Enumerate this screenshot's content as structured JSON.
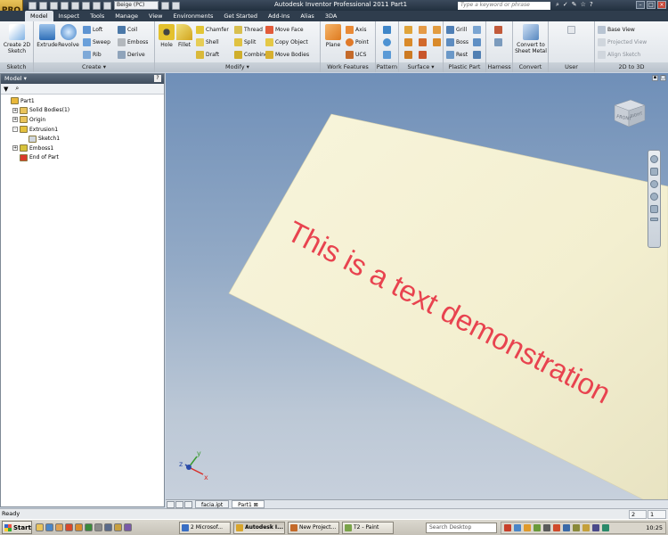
{
  "titlebar": {
    "title": "Autodesk Inventor Professional 2011 Part1",
    "app_button_label": "PRO",
    "appearance_combo": "Beige (PC)",
    "search_placeholder": "Type a keyword or phrase",
    "help_label": "?"
  },
  "tabs": [
    "Model",
    "Inspect",
    "Tools",
    "Manage",
    "View",
    "Environments",
    "Get Started",
    "Add-Ins",
    "Alias",
    "3DA"
  ],
  "active_tab": "Model",
  "ribbon": {
    "sketch": {
      "label": "Sketch",
      "create_2d_sketch": "Create 2D Sketch"
    },
    "create": {
      "label": "Create",
      "extrude": "Extrude",
      "revolve": "Revolve",
      "loft": "Loft",
      "sweep": "Sweep",
      "rib": "Rib",
      "coil": "Coil",
      "emboss": "Emboss",
      "derive": "Derive"
    },
    "modify": {
      "label": "Modify",
      "hole": "Hole",
      "fillet": "Fillet",
      "chamfer": "Chamfer",
      "shell": "Shell",
      "draft": "Draft",
      "thread": "Thread",
      "split": "Split",
      "combine": "Combine",
      "move_face": "Move Face",
      "copy_object": "Copy Object",
      "move_bodies": "Move Bodies"
    },
    "work_features": {
      "label": "Work Features",
      "plane": "Plane",
      "axis": "Axis",
      "point": "Point",
      "ucs": "UCS"
    },
    "pattern": {
      "label": "Pattern"
    },
    "surface": {
      "label": "Surface"
    },
    "plastic_part": {
      "label": "Plastic Part",
      "grill": "Grill",
      "boss": "Boss",
      "rest": "Rest"
    },
    "harness": {
      "label": "Harness"
    },
    "convert": {
      "label": "Convert",
      "convert_to_sheet_metal": "Convert to Sheet Metal"
    },
    "user_commands": {
      "label": "User Commands"
    },
    "two_d_to_3d": {
      "label": "2D to 3D",
      "base_view": "Base View",
      "projected_view": "Projected View",
      "align_sketch": "Align Sketch"
    }
  },
  "browser": {
    "title": "Model",
    "help": "?",
    "tree": [
      {
        "label": "Part1",
        "level": 0,
        "expander": "",
        "color": "#e9b83a"
      },
      {
        "label": "Solid Bodies(1)",
        "level": 1,
        "expander": "+",
        "color": "#e9c35a"
      },
      {
        "label": "Origin",
        "level": 1,
        "expander": "+",
        "color": "#e9c35a"
      },
      {
        "label": "Extrusion1",
        "level": 1,
        "expander": "-",
        "color": "#e5c13c"
      },
      {
        "label": "Sketch1",
        "level": 2,
        "expander": "",
        "color": "#cfd6de"
      },
      {
        "label": "Emboss1",
        "level": 1,
        "expander": "+",
        "color": "#d7c23a"
      },
      {
        "label": "End of Part",
        "level": 1,
        "expander": "",
        "color": "#d9392b"
      }
    ]
  },
  "viewport": {
    "embossed_text": "This is a text demonstration",
    "text_color": "#e8434f",
    "face_color": "#f4f0cf",
    "viewcube_front": "FRONT",
    "viewcube_right": "RIGHT",
    "triad": {
      "x": "x",
      "y": "y",
      "z": "z"
    }
  },
  "doc_tabs": [
    "facia.ipt",
    "Part1"
  ],
  "active_doc": "Part1",
  "status": {
    "text": "Ready",
    "count1": "2",
    "count2": "1"
  },
  "taskbar": {
    "start": "Start",
    "buttons": [
      {
        "label": "2 Microsof...",
        "color": "#3a6fc4"
      },
      {
        "label": "Autodesk I...",
        "color": "#d8a52c"
      },
      {
        "label": "New Project...",
        "color": "#c46a2a"
      },
      {
        "label": "T2 - Paint",
        "color": "#7aa34a"
      }
    ],
    "active_button": "Autodesk I...",
    "search_placeholder": "Search Desktop",
    "clock": "10:25"
  }
}
